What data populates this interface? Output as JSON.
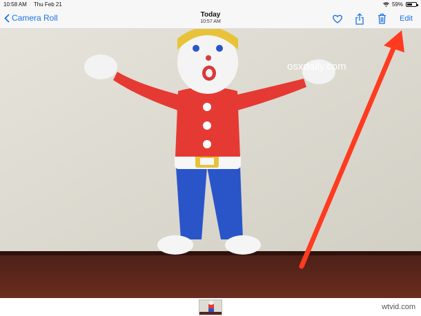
{
  "status_bar": {
    "time": "10:58 AM",
    "date": "Thu Feb 21",
    "battery": "59%",
    "battery_level": 0.59
  },
  "nav": {
    "back_label": "Camera Roll",
    "title": "Today",
    "subtitle": "10:57 AM",
    "edit_label": "Edit",
    "icons": [
      "heart-icon",
      "share-icon",
      "trash-icon"
    ],
    "accent_color": "#1a73e8"
  },
  "photo": {
    "watermark": "osxdaily.com",
    "annotation_arrow_color": "#ff3b1f"
  },
  "footer": {
    "credit": "wtvid.com"
  }
}
